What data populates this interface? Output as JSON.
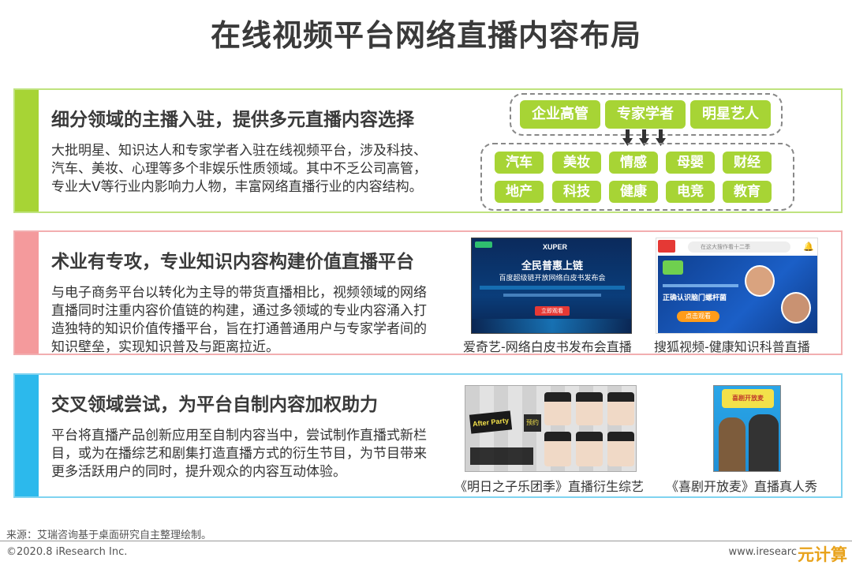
{
  "title": "在线视频平台网络直播内容布局",
  "sections": [
    {
      "heading": "细分领域的主播入驻，提供多元直播内容选择",
      "body": "大批明星、知识达人和专家学者入驻在线视频平台，涉及科技、汽车、美妆、心理等多个非娱乐性质领域。其中不乏公司高管，专业大V等行业内影响力人物，丰富网络直播行业的内容结构。",
      "top_tags": [
        "企业高管",
        "专家学者",
        "明星艺人"
      ],
      "bottom_tags_row1": [
        "汽车",
        "美妆",
        "情感",
        "母婴",
        "财经"
      ],
      "bottom_tags_row2": [
        "地产",
        "科技",
        "健康",
        "电竞",
        "教育"
      ]
    },
    {
      "heading": "术业有专攻，专业知识内容构建价值直播平台",
      "body": "与电子商务平台以转化为主导的带货直播相比，视频领域的网络直播同时注重内容价值链的构建，通过多领域的专业内容涌入打造独特的知识价值传播平台，旨在打通普通用户与专家学者间的知识壁垒，实现知识普及与距离拉近。",
      "image1": {
        "caption": "爱奇艺-网络白皮书发布会直播",
        "banner": "全民普惠上链",
        "subtitle": "百度超级链开放网络白皮书发布会",
        "brand": "XUPER",
        "button": "立即观看"
      },
      "image2": {
        "caption": "搜狐视频-健康知识科普直播",
        "headline": "正确认识脑门螺杆菌",
        "button": "点击观看",
        "search": "在这大搜作看十二季"
      }
    },
    {
      "heading": "交叉领域尝试，为平台自制内容加权助力",
      "body": "平台将直播产品创新应用至自制内容当中，尝试制作直播式新栏目，或为在播综艺和剧集打造直播方式的衍生节目，为节目带来更多活跃用户的同时，提升观众的内容互动体验。",
      "image3": {
        "caption": "《明日之子乐团季》直播衍生综艺",
        "badge": "After Party",
        "tag": "预约"
      },
      "image4": {
        "caption": "《喜剧开放麦》直播真人秀",
        "banner": "喜剧开放麦"
      }
    }
  ],
  "footer": {
    "source": "来源：艾瑞咨询基于桌面研究自主整理绘制。",
    "copyright": "©2020.8 iResearch Inc.",
    "site": "www.iresearc",
    "brand": "元计算"
  },
  "colors": {
    "green": "#a7d435",
    "pink": "#f49a9c",
    "blue": "#2cb9ec"
  }
}
